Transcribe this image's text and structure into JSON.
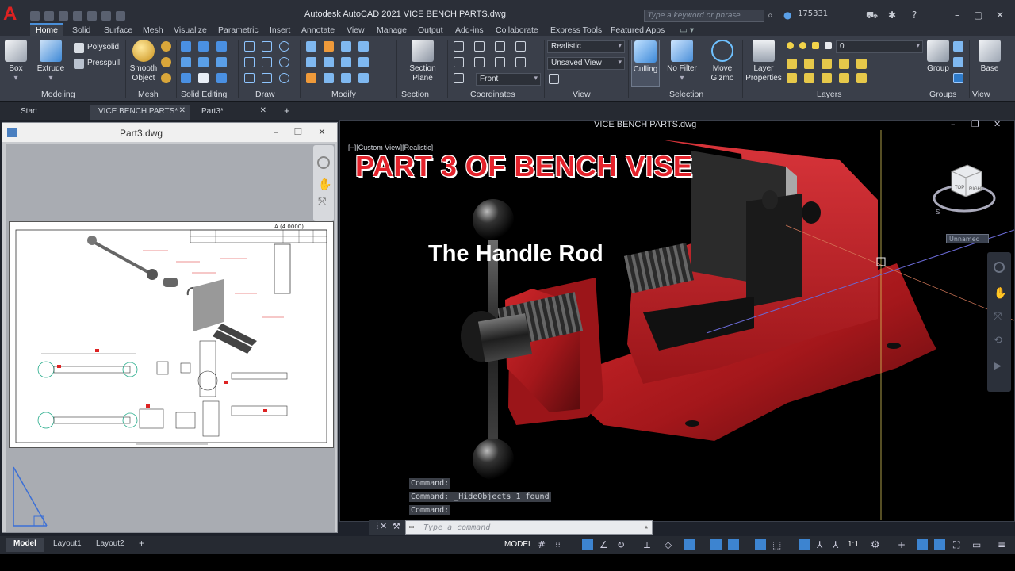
{
  "app": {
    "title": "Autodesk AutoCAD 2021    VICE BENCH PARTS.dwg",
    "logo_letter": "A",
    "search_placeholder": "Type a keyword or phrase",
    "user": "175331"
  },
  "menu_tabs": [
    "Home",
    "Solid",
    "Surface",
    "Mesh",
    "Visualize",
    "Parametric",
    "Insert",
    "Annotate",
    "View",
    "Manage",
    "Output",
    "Add-ins",
    "Collaborate",
    "Express Tools",
    "Featured Apps"
  ],
  "ribbon": {
    "box": "Box",
    "extrude": "Extrude",
    "polysolid": "Polysolid",
    "presspull": "Presspull",
    "smooth_object_1": "Smooth",
    "smooth_object_2": "Object",
    "section_plane_1": "Section",
    "section_plane_2": "Plane",
    "visual_style": "Realistic",
    "saved_view": "Unsaved View",
    "view_direction": "Front",
    "culling": "Culling",
    "no_filter": "No Filter",
    "move_gizmo_1": "Move",
    "move_gizmo_2": "Gizmo",
    "layer_properties_1": "Layer",
    "layer_properties_2": "Properties",
    "layer_current": "0",
    "group": "Group",
    "base": "Base",
    "panels": {
      "modeling": "Modeling",
      "mesh": "Mesh",
      "solid_editing": "Solid Editing",
      "draw": "Draw",
      "modify": "Modify",
      "section": "Section",
      "coordinates": "Coordinates",
      "view": "View",
      "selection": "Selection",
      "layers": "Layers",
      "groups": "Groups",
      "view2": "View"
    }
  },
  "doc_tabs": {
    "start": "Start",
    "vice": "VICE BENCH PARTS*",
    "part3": "Part3*"
  },
  "left_window": {
    "title": "Part3.dwg",
    "sheet_label": "A (4.0000)"
  },
  "right_window": {
    "title": "VICE BENCH PARTS.dwg",
    "viewport_label": "[−][Custom View][Realistic]",
    "heading": "PART 3 OF BENCH VISE",
    "subheading": "The Handle Rod",
    "navcube_unnamed": "Unnamed",
    "command_history": [
      "Command:",
      "Command:  _HideObjects 1 found",
      "Command:"
    ],
    "command_placeholder": "Type a command"
  },
  "status": {
    "layout_tabs": [
      "Model",
      "Layout1",
      "Layout2"
    ],
    "model_label": "MODEL",
    "scale": "1:1"
  },
  "colors": {
    "accent": "#4a8fd9",
    "vise_red": "#b01a1e",
    "heading_red": "#e3222b"
  }
}
